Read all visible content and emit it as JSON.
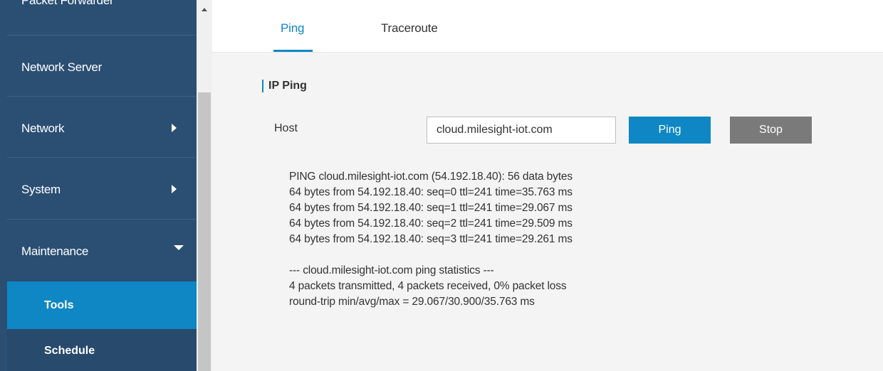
{
  "sidebar": {
    "items": [
      {
        "label": "Packet Forwarder"
      },
      {
        "label": "Network Server"
      },
      {
        "label": "Network"
      },
      {
        "label": "System"
      },
      {
        "label": "Maintenance"
      }
    ],
    "subitems": [
      {
        "label": "Tools",
        "active": true
      },
      {
        "label": "Schedule"
      }
    ]
  },
  "tabs": [
    {
      "label": "Ping",
      "active": true
    },
    {
      "label": "Traceroute"
    }
  ],
  "section": {
    "title": "IP Ping"
  },
  "form": {
    "host_label": "Host",
    "host_value": "cloud.milesight-iot.com",
    "ping_button": "Ping",
    "stop_button": "Stop"
  },
  "output": {
    "lines": [
      "PING cloud.milesight-iot.com (54.192.18.40): 56 data bytes",
      "64 bytes from 54.192.18.40: seq=0 ttl=241 time=35.763 ms",
      "64 bytes from 54.192.18.40: seq=1 ttl=241 time=29.067 ms",
      "64 bytes from 54.192.18.40: seq=2 ttl=241 time=29.509 ms",
      "64 bytes from 54.192.18.40: seq=3 ttl=241 time=29.261 ms",
      "",
      "--- cloud.milesight-iot.com ping statistics ---",
      "4 packets transmitted, 4 packets received, 0% packet loss",
      "round-trip min/avg/max = 29.067/30.900/35.763 ms"
    ]
  },
  "colors": {
    "sidebar_bg": "#2b4f73",
    "accent": "#0f87c4",
    "stop_button": "#7a7a7a",
    "content_bg": "#f4f4f4"
  }
}
